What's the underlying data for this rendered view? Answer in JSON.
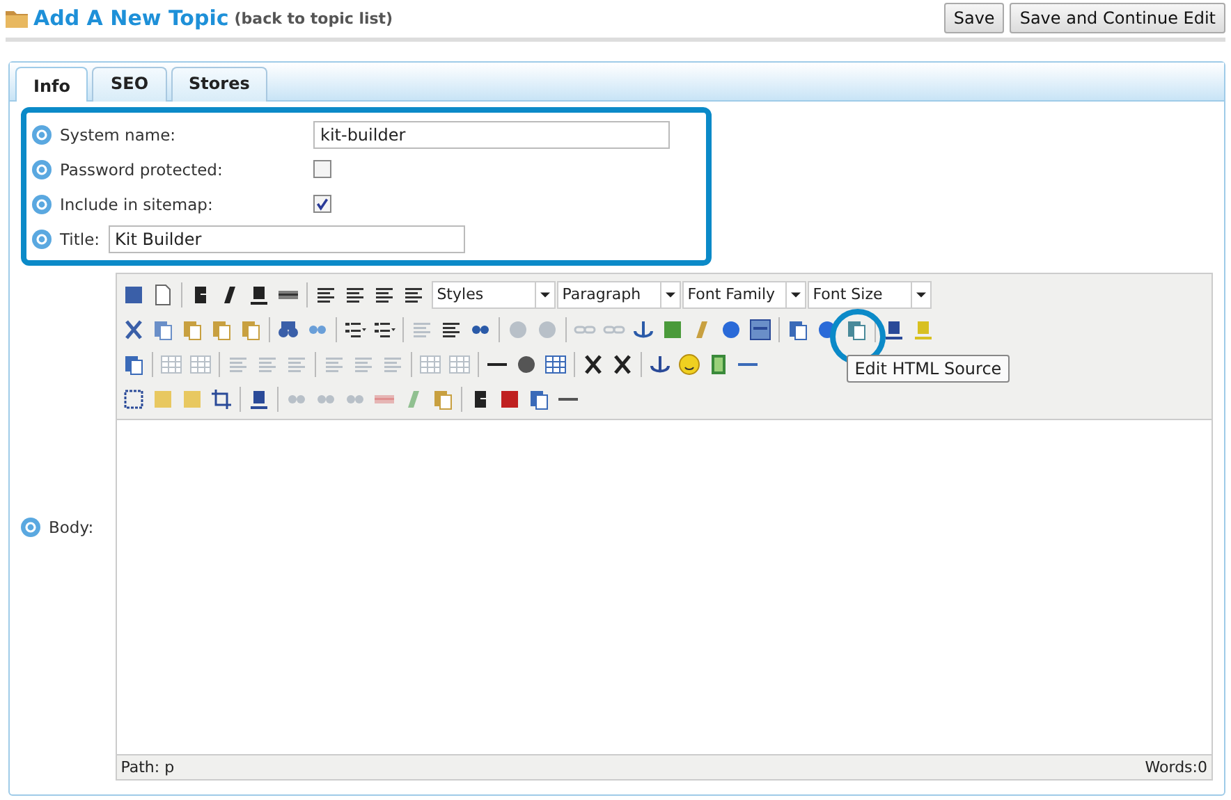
{
  "header": {
    "title": "Add A New Topic",
    "back_link": "(back to topic list)"
  },
  "buttons": [
    "Save",
    "Save and Continue Edit"
  ],
  "tabs": [
    {
      "label": "Info",
      "selected": true
    },
    {
      "label": "SEO",
      "selected": false
    },
    {
      "label": "Stores",
      "selected": false
    }
  ],
  "fields": [
    {
      "kind": "text",
      "label": "System name:",
      "value": "kit-builder"
    },
    {
      "kind": "checkbox",
      "label": "Password protected:",
      "checked": false
    },
    {
      "kind": "checkbox",
      "label": "Include in sitemap:",
      "checked": true
    },
    {
      "kind": "short-text",
      "label": "Title:",
      "value": "Kit Builder"
    }
  ],
  "editor": {
    "label": "Body:",
    "dropdowns": [
      "Styles",
      "Paragraph",
      "Font Family",
      "Font Size"
    ],
    "tooltip": "Edit HTML Source",
    "path": "Path: p",
    "words": "Words:0"
  }
}
